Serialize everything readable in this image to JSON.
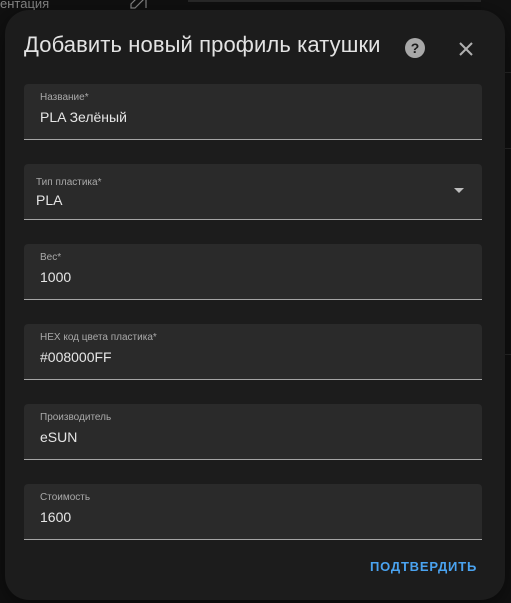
{
  "background": {
    "partial_text": "ентация"
  },
  "dialog": {
    "title": "Добавить новый профиль катушки",
    "help_icon": "question-circle-icon",
    "close_icon": "close-icon",
    "fields": {
      "name": {
        "label": "Название*",
        "value": "PLA Зелёный"
      },
      "plastic_type": {
        "label": "Тип пластика*",
        "value": "PLA"
      },
      "weight": {
        "label": "Вес*",
        "value": "1000"
      },
      "hex_color": {
        "label": "HEX код цвета пластика*",
        "value": "#008000FF"
      },
      "manufacturer": {
        "label": "Производитель",
        "value": "eSUN"
      },
      "cost": {
        "label": "Стоимость",
        "value": "1600"
      }
    },
    "confirm_label": "ПОДТВЕРДИТЬ"
  },
  "colors": {
    "accent": "#4aa3f0",
    "dialog_bg": "#1c1c1c",
    "field_bg": "#2a2a2a"
  }
}
